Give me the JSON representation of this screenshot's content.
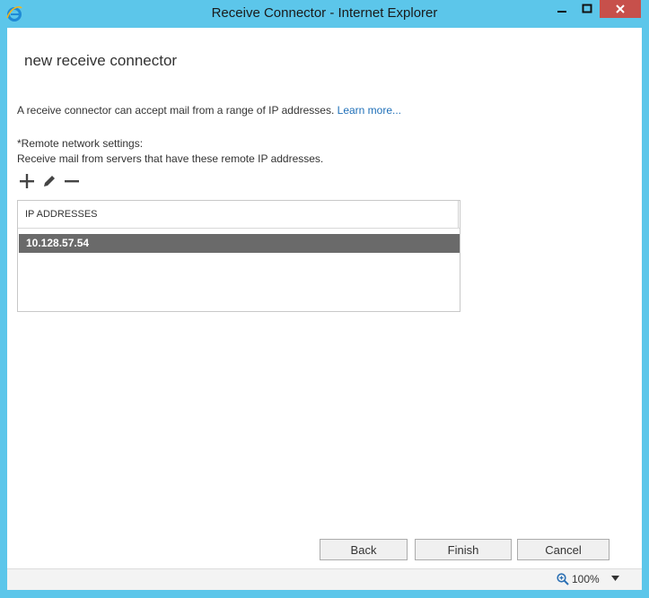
{
  "window": {
    "title": "Receive Connector - Internet Explorer",
    "controls": [
      "minimize",
      "maximize",
      "close"
    ]
  },
  "page": {
    "heading": "new receive connector",
    "intro_text": "A receive connector can accept mail from a range of IP addresses.",
    "learn_more_link": "Learn more...",
    "remote_settings_label": "*Remote network settings:",
    "remote_settings_desc": "Receive mail from servers that have these remote IP addresses."
  },
  "toolbar": {
    "icons": [
      "add-icon",
      "edit-icon",
      "remove-icon"
    ]
  },
  "ip_list": {
    "column_header": "IP ADDRESSES",
    "rows": [
      "10.128.57.54"
    ],
    "selected_index": 0
  },
  "footer": {
    "back_label": "Back",
    "finish_label": "Finish",
    "cancel_label": "Cancel"
  },
  "statusbar": {
    "zoom": "100%"
  },
  "colors": {
    "frame": "#5cc6ea",
    "close_button": "#c7504b",
    "selected_row": "#6a6a6a",
    "link": "#1e6fb8"
  }
}
